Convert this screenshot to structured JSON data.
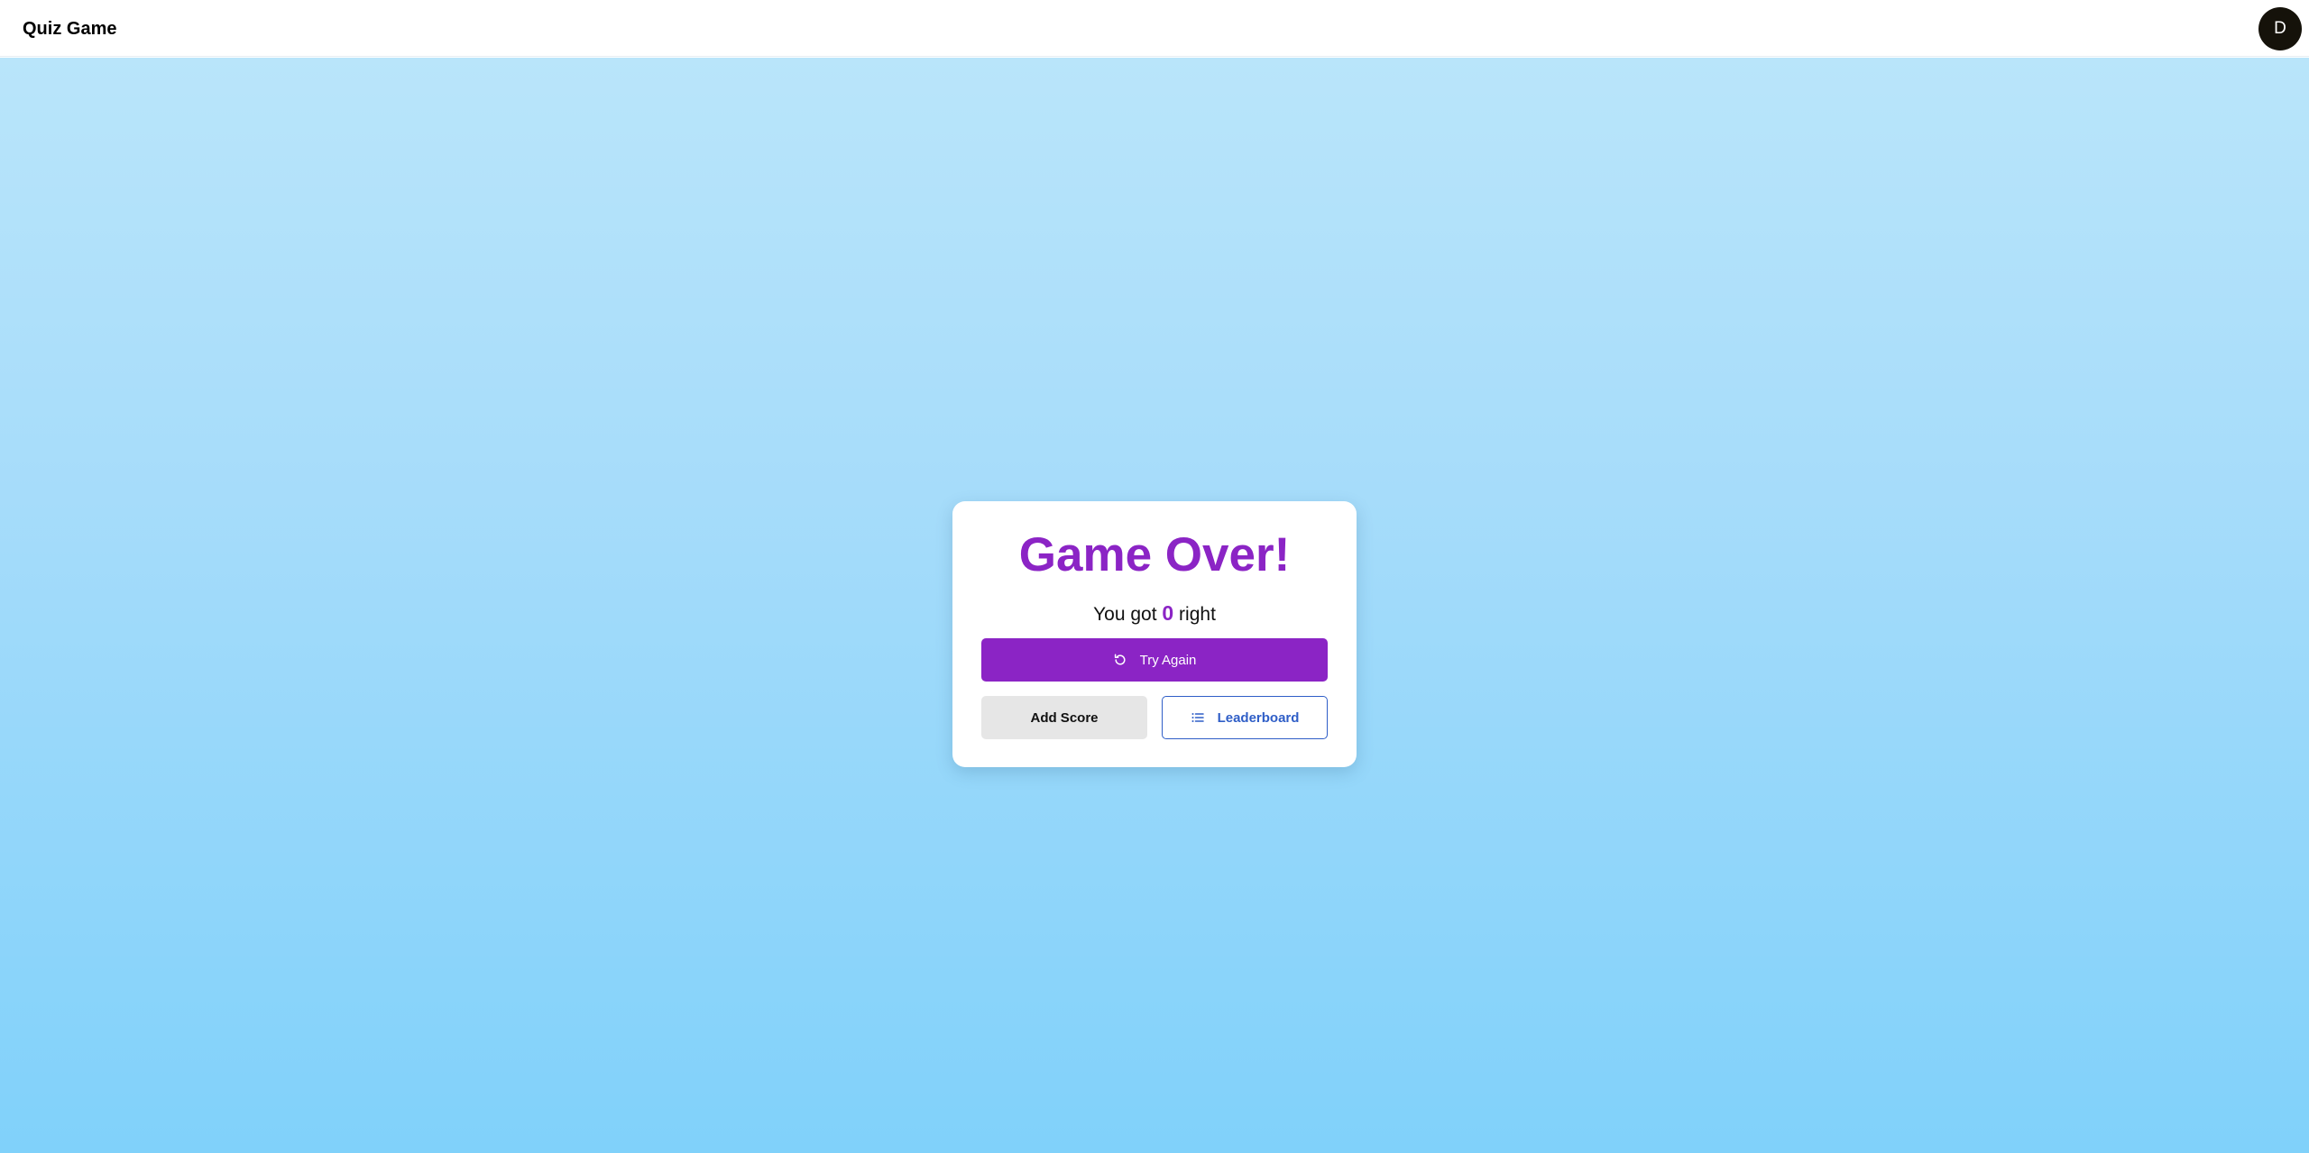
{
  "header": {
    "app_title": "Quiz Game",
    "avatar_initial": "D"
  },
  "result": {
    "title": "Game Over!",
    "score_prefix": "You got",
    "score_value": "0",
    "score_suffix": "right"
  },
  "actions": {
    "try_again_label": "Try Again",
    "try_again_icon": "refresh-icon",
    "add_score_label": "Add Score",
    "leaderboard_label": "Leaderboard",
    "leaderboard_icon": "list-icon"
  },
  "colors": {
    "accent_purple": "#8b24c5",
    "accent_blue": "#2f5ec7",
    "background_top": "#b9e5fa",
    "background_bottom": "#80d1fa"
  }
}
